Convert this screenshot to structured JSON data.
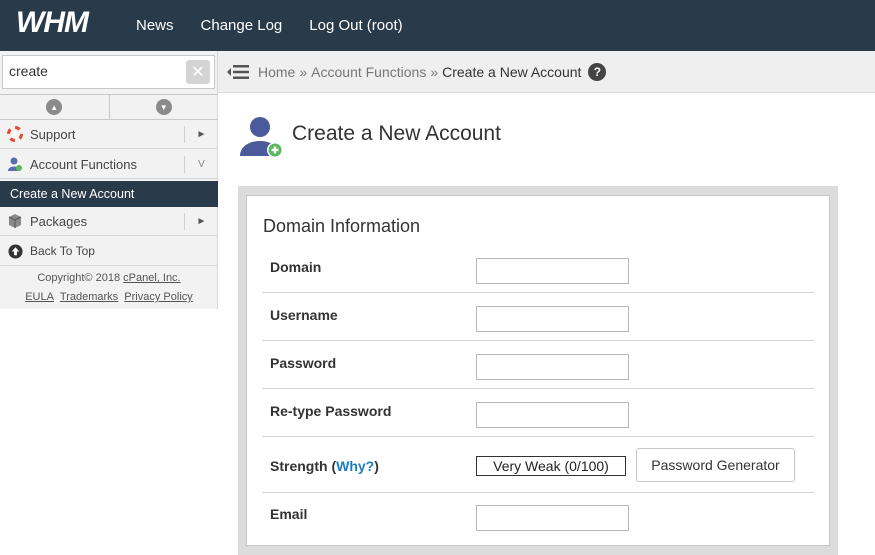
{
  "topbar": {
    "logo_text": "WHM",
    "nav": [
      "News",
      "Change Log",
      "Log Out (root)"
    ],
    "bg_color": "#293a4a"
  },
  "sidebar": {
    "search_value": "create",
    "items": [
      {
        "label": "Support",
        "icon": "lifebuoy-icon",
        "indicator": "►"
      },
      {
        "label": "Account Functions",
        "icon": "user-icon",
        "indicator": "V"
      },
      {
        "label": "Create a New Account",
        "active": true
      },
      {
        "label": "Packages",
        "icon": "package-icon",
        "indicator": "►"
      },
      {
        "label": "Back To Top",
        "icon": "arrow-up-circle-icon"
      }
    ],
    "copyright": "Copyright© 2018",
    "cpanel_link": "cPanel, Inc.",
    "footer_links": [
      "EULA",
      "Trademarks",
      "Privacy Policy"
    ]
  },
  "breadcrumb": {
    "items": [
      "Home",
      "Account Functions",
      "Create a New Account"
    ],
    "separator": "»",
    "help": "?"
  },
  "page": {
    "title": "Create a New Account"
  },
  "form": {
    "section_title": "Domain Information",
    "fields": [
      {
        "label": "Domain",
        "value": ""
      },
      {
        "label": "Username",
        "value": ""
      },
      {
        "label": "Password",
        "value": ""
      },
      {
        "label": "Re-type Password",
        "value": ""
      },
      {
        "label": "Email",
        "value": ""
      }
    ],
    "strength_label": "Strength",
    "why_link": "Why?",
    "strength_value": "Very Weak (0/100)",
    "password_generator": "Password Generator"
  },
  "colors": {
    "accent_link": "#1a7ec2",
    "active_item": "#293a4a",
    "success_green": "#5cb85c"
  }
}
